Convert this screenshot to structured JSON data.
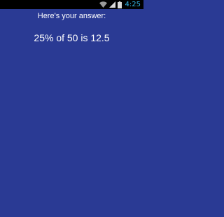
{
  "status_bar": {
    "time": "4:25",
    "icons": [
      "wifi-icon",
      "signal-icon",
      "battery-icon"
    ],
    "accent_color": "#33b5e5"
  },
  "screen": {
    "background_color": "#2a3a94",
    "heading": "Here's your answer:",
    "answer": "25% of 50 is 12.5"
  }
}
